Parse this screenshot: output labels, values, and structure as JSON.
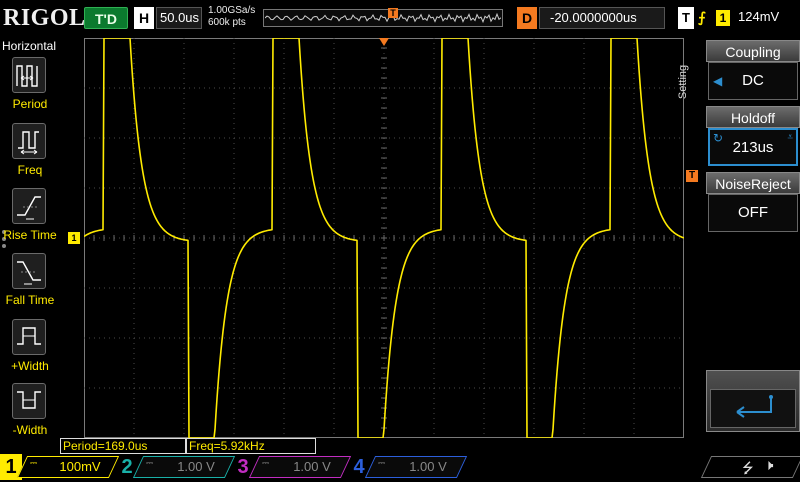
{
  "topbar": {
    "logo": "RIGOL",
    "run_status": "T'D",
    "horiz_letter": "H",
    "timebase": "50.0us",
    "sample_rate": "1.00GSa/s",
    "memory_depth": "600k pts",
    "trig_pos_marker": "T",
    "delay_letter": "D",
    "delay_value": "-20.0000000us",
    "trig_letter": "T",
    "trig_edge_icon": "rising-edge",
    "trig_source": "1",
    "trig_level": "124mV"
  },
  "left_menu": {
    "title": "Horizontal",
    "items": [
      {
        "label": "Period",
        "icon": "period-icon"
      },
      {
        "label": "Freq",
        "icon": "freq-icon"
      },
      {
        "label": "Rise Time",
        "icon": "rise-time-icon"
      },
      {
        "label": "Fall Time",
        "icon": "fall-time-icon"
      },
      {
        "label": "+Width",
        "icon": "pos-width-icon"
      },
      {
        "label": "-Width",
        "icon": "neg-width-icon"
      }
    ]
  },
  "right_menu": {
    "tab_label": "Setting",
    "coupling": {
      "title": "Coupling",
      "value": "DC"
    },
    "holdoff": {
      "title": "Holdoff",
      "value": "213us"
    },
    "noise_reject": {
      "title": "NoiseReject",
      "value": "OFF"
    },
    "back_icon": "return-arrow-icon"
  },
  "markers": {
    "ch1": "1",
    "trig_level": "T"
  },
  "measurements": {
    "period": "Period=169.0us",
    "freq": "Freq=5.92kHz"
  },
  "channels": [
    {
      "num": "1",
      "coupling": "DC",
      "scale": "100mV",
      "color": "#ffeb00",
      "active": true
    },
    {
      "num": "2",
      "coupling": "DC",
      "scale": "1.00 V",
      "color": "#19b0a8",
      "active": false
    },
    {
      "num": "3",
      "coupling": "DC",
      "scale": "1.00 V",
      "color": "#c22dc2",
      "active": false
    },
    {
      "num": "4",
      "coupling": "DC",
      "scale": "1.00 V",
      "color": "#2c5fdc",
      "active": false
    }
  ],
  "colors": {
    "ch1": "#ffeb00",
    "trigger": "#f47a20",
    "grid": "#4a4a4a"
  },
  "waveform": {
    "channel": "1",
    "time_per_div_us": 50,
    "period_us": 169.0,
    "v_per_div_mV": 100
  }
}
